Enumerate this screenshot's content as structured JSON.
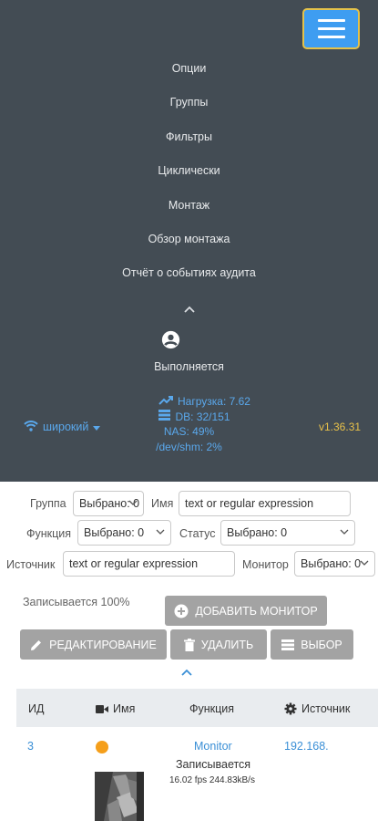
{
  "nav": {
    "menu": [
      "Опции",
      "Группы",
      "Фильтры",
      "Циклически",
      "Монтаж",
      "Обзор монтажа",
      "Отчёт о событиях аудита"
    ],
    "status": "Выполняется",
    "stats": {
      "load": "Нагрузка: 7.62",
      "db": "DB: 32/151",
      "nas": "NAS: 49%",
      "shm": "/dev/shm: 2%"
    },
    "bandwidth": "широкий",
    "version": "v1.36.31"
  },
  "filters": {
    "group_label": "Группа",
    "group_value": "Выбрано: 0",
    "name_label": "Имя",
    "name_placeholder": "text or regular expression",
    "function_label": "Функция",
    "function_value": "Выбрано: 0",
    "status_label": "Статус",
    "status_value": "Выбрано: 0",
    "source_label": "Источник",
    "source_placeholder": "text or regular expression",
    "monitor_label": "Монитор",
    "monitor_value": "Выбрано: 0"
  },
  "summary": "Записывается 100%",
  "buttons": {
    "add": "ДОБАВИТЬ МОНИТОР",
    "edit": "РЕДАКТИРОВАНИЕ",
    "delete": "УДАЛИТЬ",
    "select": "ВЫБОР"
  },
  "table": {
    "headers": {
      "id": "ИД",
      "name": "Имя",
      "function": "Функция",
      "source": "Источник"
    },
    "rows": [
      {
        "id": "3",
        "function": "Monitor",
        "status": "Записывается",
        "fps": "16.02 fps 244.83kB/s",
        "source": "192.168."
      }
    ]
  },
  "colors": {
    "nav_bg": "#434c54",
    "accent": "#3e9df1",
    "version": "#e8c14a",
    "button_bg": "#a3a3a3",
    "status_dot": "#f59f1b"
  }
}
